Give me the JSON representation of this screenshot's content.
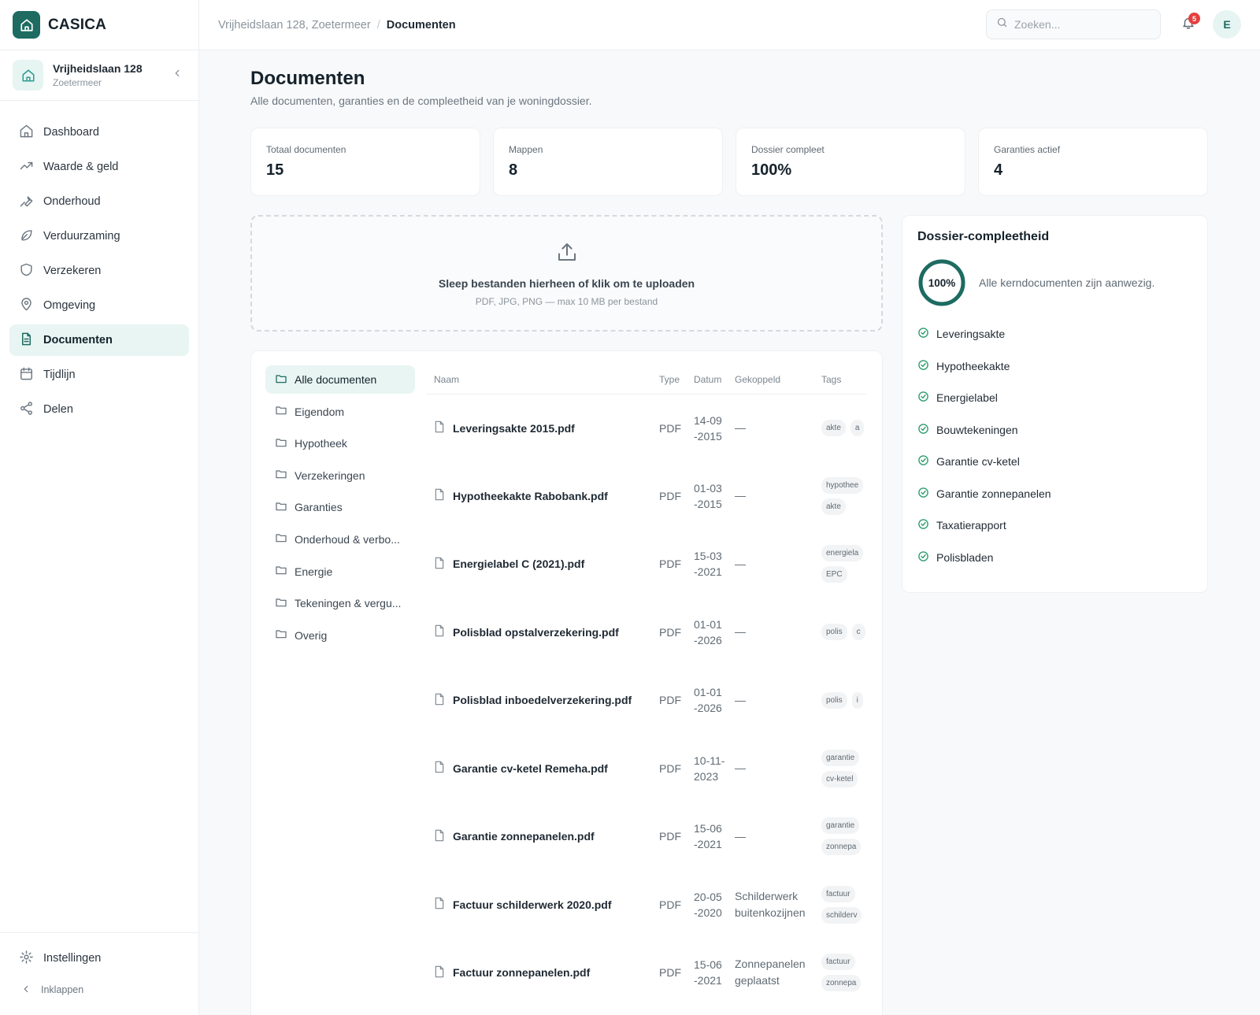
{
  "brand": {
    "name": "CASICA"
  },
  "property": {
    "name": "Vrijheidslaan 128",
    "city": "Zoetermeer"
  },
  "nav": [
    {
      "label": "Dashboard",
      "icon": "home-icon"
    },
    {
      "label": "Waarde & geld",
      "icon": "trending-up-icon"
    },
    {
      "label": "Onderhoud",
      "icon": "wrench-icon"
    },
    {
      "label": "Verduurzaming",
      "icon": "leaf-icon"
    },
    {
      "label": "Verzekeren",
      "icon": "shield-icon"
    },
    {
      "label": "Omgeving",
      "icon": "map-pin-icon"
    },
    {
      "label": "Documenten",
      "icon": "file-text-icon",
      "active": true
    },
    {
      "label": "Tijdlijn",
      "icon": "calendar-icon"
    },
    {
      "label": "Delen",
      "icon": "share-icon"
    }
  ],
  "sidebar_bottom": {
    "settings": "Instellingen",
    "collapse": "Inklappen"
  },
  "breadcrumb": {
    "parent": "Vrijheidslaan 128, Zoetermeer",
    "separator": "/",
    "current": "Documenten"
  },
  "search": {
    "placeholder": "Zoeken..."
  },
  "notifications": {
    "count": "5"
  },
  "user": {
    "initial": "E"
  },
  "page": {
    "title": "Documenten",
    "subtitle": "Alle documenten, garanties en de compleetheid van je woningdossier."
  },
  "stats": [
    {
      "label": "Totaal documenten",
      "value": "15"
    },
    {
      "label": "Mappen",
      "value": "8"
    },
    {
      "label": "Dossier compleet",
      "value": "100%"
    },
    {
      "label": "Garanties actief",
      "value": "4"
    }
  ],
  "upload": {
    "title": "Sleep bestanden hierheen of klik om te uploaden",
    "hint": "PDF, JPG, PNG — max 10 MB per bestand"
  },
  "folders": [
    {
      "label": "Alle documenten",
      "active": true
    },
    {
      "label": "Eigendom"
    },
    {
      "label": "Hypotheek"
    },
    {
      "label": "Verzekeringen"
    },
    {
      "label": "Garanties"
    },
    {
      "label": "Onderhoud & verbo..."
    },
    {
      "label": "Energie"
    },
    {
      "label": "Tekeningen & vergu..."
    },
    {
      "label": "Overig"
    }
  ],
  "table": {
    "columns": [
      "Naam",
      "Type",
      "Datum",
      "Gekoppeld",
      "Tags"
    ],
    "rows": [
      {
        "name": "Leveringsakte 2015.pdf",
        "type": "PDF",
        "date": "14-09-2015",
        "linked": "—",
        "tags": [
          "akte",
          "a"
        ]
      },
      {
        "name": "Hypotheekakte Rabobank.pdf",
        "type": "PDF",
        "date": "01-03-2015",
        "linked": "—",
        "tags": [
          "hypothee",
          "akte"
        ]
      },
      {
        "name": "Energielabel C (2021).pdf",
        "type": "PDF",
        "date": "15-03-2021",
        "linked": "—",
        "tags": [
          "energiela",
          "EPC"
        ]
      },
      {
        "name": "Polisblad opstalverzekering.pdf",
        "type": "PDF",
        "date": "01-01-2026",
        "linked": "—",
        "tags": [
          "polis",
          "c"
        ]
      },
      {
        "name": "Polisblad inboedelverzekering.pdf",
        "type": "PDF",
        "date": "01-01-2026",
        "linked": "—",
        "tags": [
          "polis",
          "i"
        ]
      },
      {
        "name": "Garantie cv-ketel Remeha.pdf",
        "type": "PDF",
        "date": "10-11-2023",
        "linked": "—",
        "tags": [
          "garantie",
          "cv-ketel"
        ]
      },
      {
        "name": "Garantie zonnepanelen.pdf",
        "type": "PDF",
        "date": "15-06-2021",
        "linked": "—",
        "tags": [
          "garantie",
          "zonnepa"
        ]
      },
      {
        "name": "Factuur schilderwerk 2020.pdf",
        "type": "PDF",
        "date": "20-05-2020",
        "linked": "Schilderwerk buitenkozijnen",
        "tags": [
          "factuur",
          "schilderv"
        ]
      },
      {
        "name": "Factuur zonnepanelen.pdf",
        "type": "PDF",
        "date": "15-06-2021",
        "linked": "Zonnepanelen geplaatst",
        "tags": [
          "factuur",
          "zonnepa"
        ]
      }
    ]
  },
  "completeness": {
    "title": "Dossier-compleetheid",
    "percent_label": "100%",
    "percent": 100,
    "message": "Alle kerndocumenten zijn aanwezig.",
    "items": [
      "Leveringsakte",
      "Hypotheekakte",
      "Energielabel",
      "Bouwtekeningen",
      "Garantie cv-ketel",
      "Garantie zonnepanelen",
      "Taxatierapport",
      "Polisbladen"
    ]
  },
  "colors": {
    "accent": "#1d6b61",
    "accent_light": "#e8f5f3",
    "check": "#2f9e6e",
    "badge": "#e53e3e"
  }
}
